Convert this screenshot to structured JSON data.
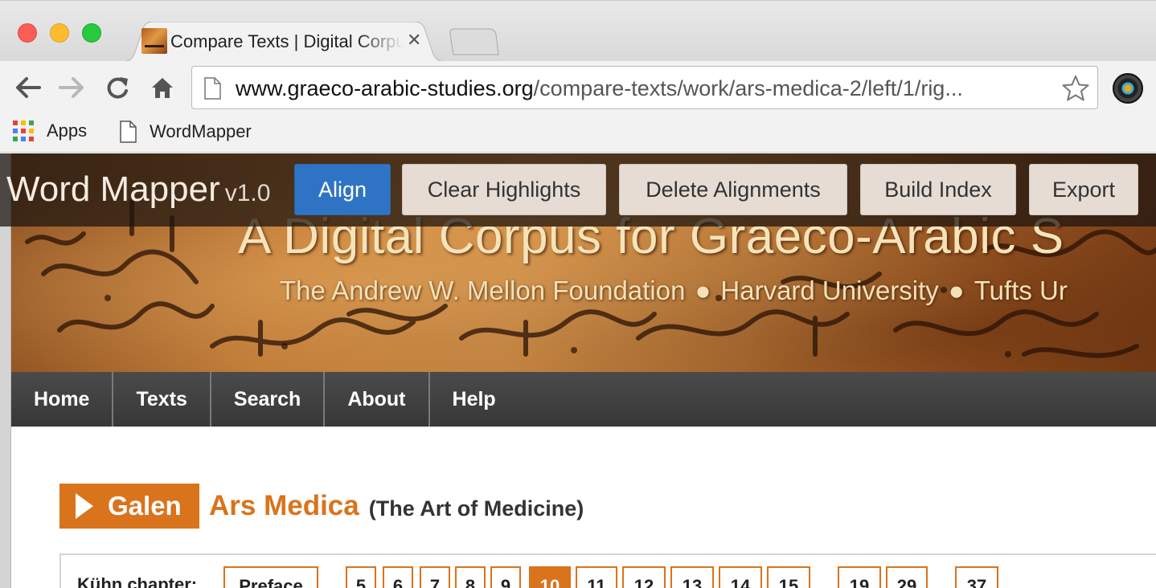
{
  "browser": {
    "tab_title": "Compare Texts | Digital Corpus for Graeco-Arabic Studies",
    "url_host": "www.graeco-arabic-studies.org",
    "url_path": "/compare-texts/work/ars-medica-2/left/1/rig...",
    "bookmarks": [
      {
        "label": "Apps",
        "icon": "apps-grid-icon"
      },
      {
        "label": "WordMapper",
        "icon": "page-icon"
      }
    ]
  },
  "wordmapper": {
    "title": "Word Mapper",
    "version": "v1.0",
    "buttons": {
      "align": "Align",
      "clear_highlights": "Clear Highlights",
      "delete_alignments": "Delete Alignments",
      "build_index": "Build Index",
      "export": "Export"
    }
  },
  "banner": {
    "title": "A Digital Corpus for Graeco-Arabic S",
    "sponsor_1": "The Andrew W. Mellon Foundation",
    "sponsor_2": "Harvard University",
    "sponsor_3": "Tufts Ur",
    "separator": "●"
  },
  "nav": {
    "items": [
      "Home",
      "Texts",
      "Search",
      "About",
      "Help"
    ]
  },
  "work": {
    "author": "Galen",
    "title": "Ars Medica",
    "translation": "(The Art of Medicine)"
  },
  "chapters": {
    "label": "Kühn chapter:",
    "items": [
      "Preface",
      "5",
      "6",
      "7",
      "8",
      "9",
      "10",
      "11",
      "12",
      "13",
      "14",
      "15",
      "19",
      "29",
      "37"
    ],
    "active": "10"
  },
  "colors": {
    "accent": "#d9731c",
    "align_button": "#2f74c4",
    "nav_bg": "#404040"
  }
}
